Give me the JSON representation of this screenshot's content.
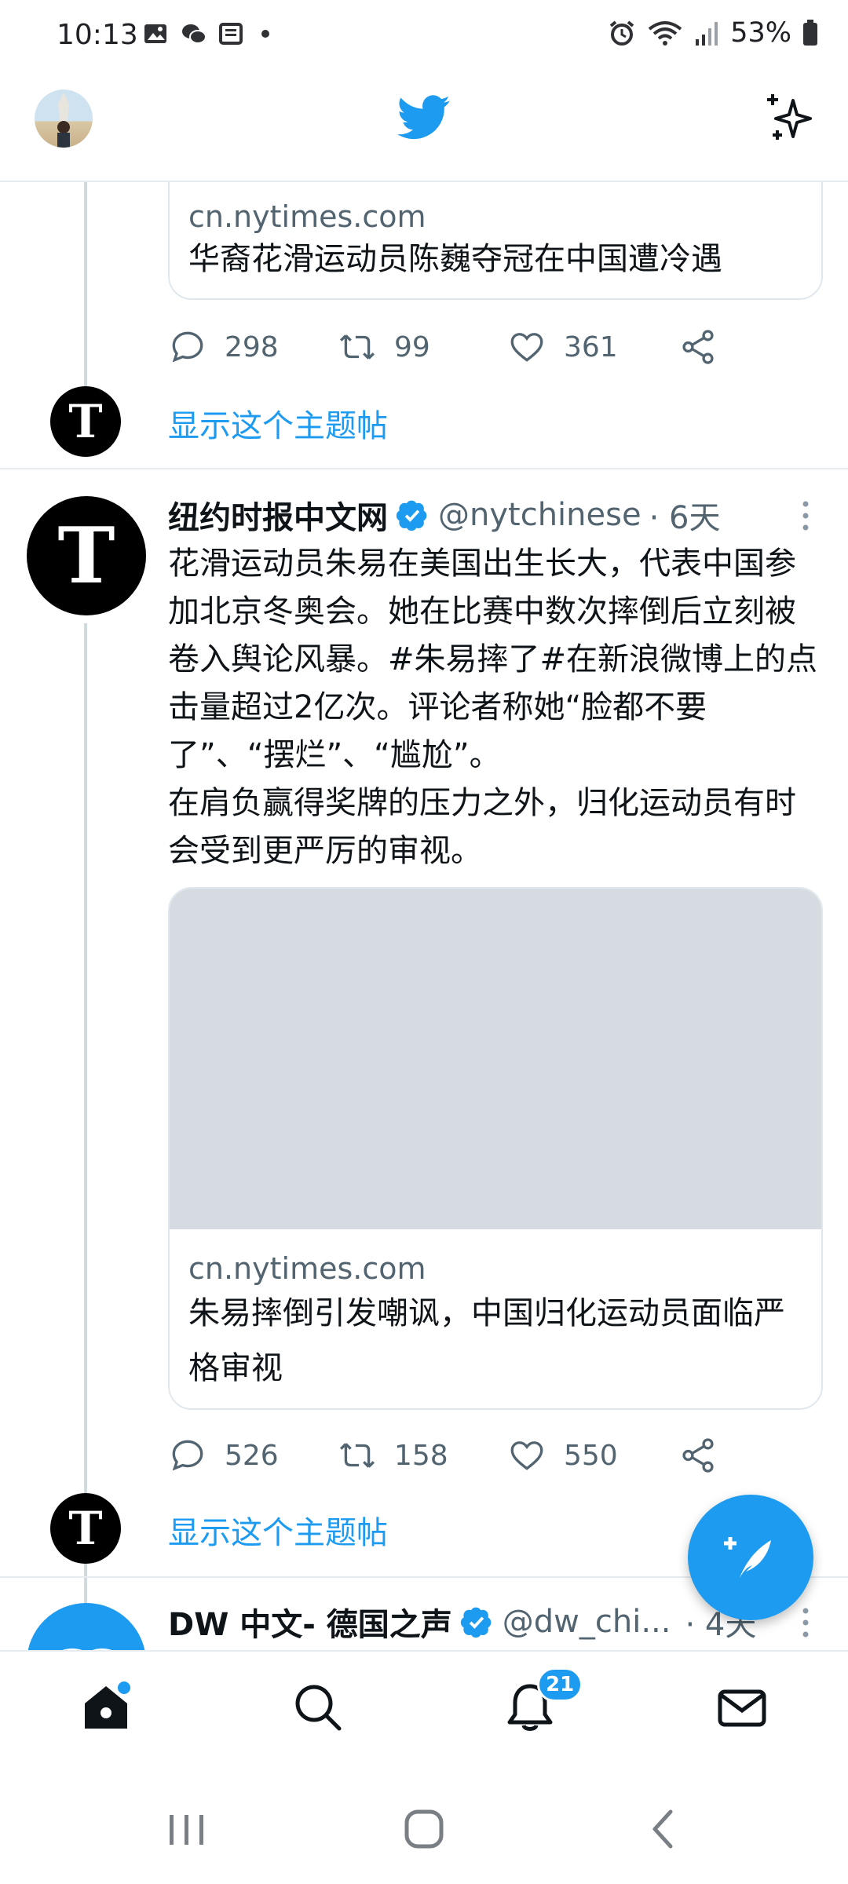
{
  "status_bar": {
    "time": "10:13",
    "battery": "53%"
  },
  "colors": {
    "accent": "#1d9bf0",
    "text_primary": "#0f1419",
    "text_secondary": "#536471",
    "divider": "#e6ecf0"
  },
  "feed": {
    "tweet1": {
      "card_domain": "cn.nytimes.com",
      "card_title": "华裔花滑运动员陈巍夺冠在中国遭冷遇",
      "replies": "298",
      "retweets": "99",
      "likes": "361",
      "show_thread": "显示这个主题帖"
    },
    "tweet2": {
      "author": "纽约时报中文网",
      "handle": "@nytchinese",
      "time": "· 6天",
      "text_lines": [
        "花滑运动员朱易在美国出生长大，代表中国参加北京冬奥会。她在比赛中数次摔倒后立刻被卷入舆论风暴。#朱易摔了#在新浪微博上的点击量超过2亿次。评论者称她“脸都不要了”、“摆烂”、“尴尬”。",
        "在肩负赢得奖牌的压力之外，归化运动员有时会受到更严厉的审视。"
      ],
      "card_domain": "cn.nytimes.com",
      "card_title": "朱易摔倒引发嘲讽，中国归化运动员面临严格审视",
      "replies": "526",
      "retweets": "158",
      "likes": "550",
      "show_thread": "显示这个主题帖"
    },
    "tweet3": {
      "author": "DW 中文- 德国之声",
      "handle": "@dw_chi...",
      "time": "· 4天"
    }
  },
  "nav": {
    "notifications_badge": "21"
  },
  "icons": {
    "home": "home-icon",
    "search": "search-icon",
    "notifications": "bell-icon",
    "messages": "mail-icon",
    "compose": "compose-feather-icon",
    "sparkle": "sparkle-icon"
  },
  "avatars": {
    "nyt_glyph": "T"
  }
}
